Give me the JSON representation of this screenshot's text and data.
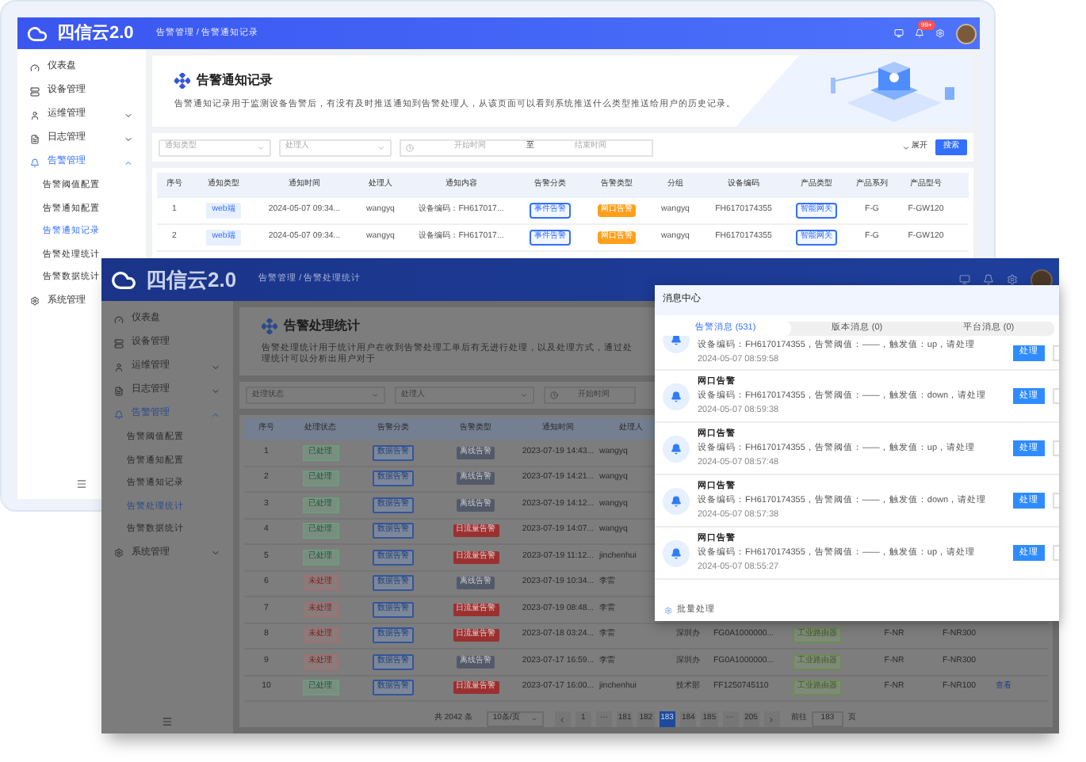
{
  "back_window": {
    "app_name": "四信云2.0",
    "breadcrumb": "告警管理 / 告警通知记录",
    "badge": "99+",
    "sidebar": [
      {
        "label": "仪表盘",
        "kind": "dashboard",
        "expandable": false,
        "expanded": false,
        "selected": false
      },
      {
        "label": "设备管理",
        "kind": "device",
        "expandable": false,
        "expanded": false,
        "selected": false
      },
      {
        "label": "运维管理",
        "kind": "ops",
        "expandable": true,
        "expanded": false,
        "selected": false
      },
      {
        "label": "日志管理",
        "kind": "log",
        "expandable": true,
        "expanded": false,
        "selected": false
      },
      {
        "label": "告警管理",
        "kind": "alarm",
        "expandable": true,
        "expanded": true,
        "selected": true,
        "children": [
          {
            "label": "告警阈值配置",
            "selected": false
          },
          {
            "label": "告警通知配置",
            "selected": false
          },
          {
            "label": "告警通知记录",
            "selected": true
          },
          {
            "label": "告警处理统计",
            "selected": false
          },
          {
            "label": "告警数据统计",
            "selected": false
          }
        ]
      },
      {
        "label": "系统管理",
        "kind": "system",
        "expandable": false,
        "expanded": false,
        "selected": false
      }
    ],
    "banner": {
      "title": "告警通知记录",
      "description": "告警通知记录用于监测设备告警后，有没有及时推送通知到告警处理人，从该页面可以看到系统推送什么类型推送给用户的历史记录。"
    },
    "filters": [
      {
        "placeholder": "通知类型"
      },
      {
        "placeholder": "处理人"
      }
    ],
    "date_range": {
      "start_placeholder": "开始时间",
      "separator": "至",
      "end_placeholder": "结束时间"
    },
    "expand_label": "展开",
    "search_button": "搜索",
    "table": {
      "columns": [
        {
          "label": "序号",
          "kind": "text"
        },
        {
          "label": "通知类型",
          "kind": "tag"
        },
        {
          "label": "通知时间",
          "kind": "text"
        },
        {
          "label": "处理人",
          "kind": "text"
        },
        {
          "label": "通知内容",
          "kind": "text"
        },
        {
          "label": "告警分类",
          "kind": "outline"
        },
        {
          "label": "告警类型",
          "kind": "warn"
        },
        {
          "label": "分组",
          "kind": "text"
        },
        {
          "label": "设备编码",
          "kind": "text"
        },
        {
          "label": "产品类型",
          "kind": "outline"
        },
        {
          "label": "产品系列",
          "kind": "text"
        },
        {
          "label": "产品型号",
          "kind": "text"
        }
      ],
      "rows": [
        {
          "cells": [
            "1",
            "web端",
            "2024-05-07 09:34...",
            "wangyq",
            "设备编码：FH617017...",
            "事件告警",
            "网口告警",
            "wangyq",
            "FH6170174355",
            "智能网关",
            "F-G",
            "F-GW120"
          ]
        },
        {
          "cells": [
            "2",
            "web端",
            "2024-05-07 09:34...",
            "wangyq",
            "设备编码：FH617017...",
            "事件告警",
            "网口告警",
            "wangyq",
            "FH6170174355",
            "智能网关",
            "F-G",
            "F-GW120"
          ]
        }
      ]
    }
  },
  "front_window": {
    "app_name": "四信云2.0",
    "breadcrumb": "告警管理 / 告警处理统计",
    "sidebar": [
      {
        "label": "仪表盘",
        "kind": "dashboard",
        "expandable": false,
        "expanded": false,
        "selected": false
      },
      {
        "label": "设备管理",
        "kind": "device",
        "expandable": false,
        "expanded": false,
        "selected": false
      },
      {
        "label": "运维管理",
        "kind": "ops",
        "expandable": true,
        "expanded": false,
        "selected": false
      },
      {
        "label": "日志管理",
        "kind": "log",
        "expandable": true,
        "expanded": false,
        "selected": false
      },
      {
        "label": "告警管理",
        "kind": "alarm",
        "expandable": true,
        "expanded": true,
        "selected": true,
        "children": [
          {
            "label": "告警阈值配置",
            "selected": false
          },
          {
            "label": "告警通知配置",
            "selected": false
          },
          {
            "label": "告警通知记录",
            "selected": false
          },
          {
            "label": "告警处理统计",
            "selected": true
          },
          {
            "label": "告警数据统计",
            "selected": false
          }
        ]
      },
      {
        "label": "系统管理",
        "kind": "system",
        "expandable": true,
        "expanded": false,
        "selected": false
      }
    ],
    "banner": {
      "title": "告警处理统计",
      "description": "告警处理统计用于统计用户在收到告警处理工单后有无进行处理，以及处理方式，通过处理统计可以分析出用户对于"
    },
    "filters": [
      {
        "placeholder": "处理状态"
      },
      {
        "placeholder": "处理人"
      }
    ],
    "date_start_placeholder": "开始时间",
    "table": {
      "columns": [
        "序号",
        "处理状态",
        "告警分类",
        "告警类型",
        "通知时间",
        "处理人"
      ],
      "rows": [
        {
          "number": "1",
          "status": "已处理",
          "handled": true,
          "category": "数据告警",
          "type": {
            "label": "离线告警",
            "kind": "offline"
          },
          "time": "2023-07-19 14:43...",
          "processor": "wangyq"
        },
        {
          "number": "2",
          "status": "已处理",
          "handled": true,
          "category": "数据告警",
          "type": {
            "label": "离线告警",
            "kind": "offline"
          },
          "time": "2023-07-19 14:21...",
          "processor": "wangyq"
        },
        {
          "number": "3",
          "status": "已处理",
          "handled": true,
          "category": "数据告警",
          "type": {
            "label": "离线告警",
            "kind": "offline"
          },
          "time": "2023-07-19 14:12...",
          "processor": "wangyq"
        },
        {
          "number": "4",
          "status": "已处理",
          "handled": true,
          "category": "数据告警",
          "type": {
            "label": "日流量告警",
            "kind": "traffic"
          },
          "time": "2023-07-19 14:07...",
          "processor": "wangyq"
        },
        {
          "number": "5",
          "status": "已处理",
          "handled": true,
          "category": "数据告警",
          "type": {
            "label": "日流量告警",
            "kind": "traffic"
          },
          "time": "2023-07-19 11:12...",
          "processor": "jinchenhui"
        },
        {
          "number": "6",
          "status": "未处理",
          "handled": false,
          "category": "数据告警",
          "type": {
            "label": "离线告警",
            "kind": "offline"
          },
          "time": "2023-07-19 10:34...",
          "processor": "李雷"
        },
        {
          "number": "7",
          "status": "未处理",
          "handled": false,
          "category": "数据告警",
          "type": {
            "label": "日流量告警",
            "kind": "traffic"
          },
          "time": "2023-07-19 08:48...",
          "processor": "李雷"
        },
        {
          "number": "8",
          "status": "未处理",
          "handled": false,
          "category": "数据告警",
          "type": {
            "label": "日流量告警",
            "kind": "traffic"
          },
          "time": "2023-07-18 03:24...",
          "processor": "李雷",
          "department": "深圳办",
          "device_code": "FG0A1000000...",
          "product_type": "工业路由器",
          "series": "F-NR",
          "model": "F-NR300"
        },
        {
          "number": "9",
          "status": "未处理",
          "handled": false,
          "category": "数据告警",
          "type": {
            "label": "离线告警",
            "kind": "offline"
          },
          "time": "2023-07-17 16:59...",
          "processor": "李雷",
          "department": "深圳办",
          "device_code": "FG0A1000000...",
          "product_type": "工业路由器",
          "series": "F-NR",
          "model": "F-NR300"
        },
        {
          "number": "10",
          "status": "已处理",
          "handled": true,
          "category": "数据告警",
          "type": {
            "label": "日流量告警",
            "kind": "traffic"
          },
          "time": "2023-07-17 16:00...",
          "processor": "jinchenhui",
          "department": "技术部",
          "device_code": "FF1250745110",
          "product_type": "工业路由器",
          "series": "F-NR",
          "model": "F-NR100",
          "action": "查看"
        }
      ]
    },
    "pagination": {
      "total": "共 2042 条",
      "page_size": "10条/页",
      "pages": [
        {
          "label": "1",
          "selected": false
        },
        {
          "label": "···",
          "selected": false
        },
        {
          "label": "181",
          "selected": false
        },
        {
          "label": "182",
          "selected": false
        },
        {
          "label": "183",
          "selected": true
        },
        {
          "label": "184",
          "selected": false
        },
        {
          "label": "185",
          "selected": false
        },
        {
          "label": "···",
          "selected": false
        },
        {
          "label": "205",
          "selected": false
        }
      ],
      "goto_label": "前往",
      "goto_value": "183",
      "goto_suffix": "页"
    },
    "message_center": {
      "title": "消息中心",
      "tabs": [
        {
          "label": "告警消息 (531)",
          "selected": true
        },
        {
          "label": "版本消息 (0)",
          "selected": false
        },
        {
          "label": "平台消息 (0)",
          "selected": false
        }
      ],
      "messages": [
        {
          "text": "设备编码：FH6170174355，告警阈值：——，触发值：up，请处理",
          "time": "2024-05-07 08:59:58",
          "button": "处理"
        },
        {
          "title": "网口告警",
          "text": "设备编码：FH6170174355，告警阈值：——，触发值：down，请处理",
          "time": "2024-05-07 08:59:38",
          "button": "处理"
        },
        {
          "title": "网口告警",
          "text": "设备编码：FH6170174355，告警阈值：——，触发值：up，请处理",
          "time": "2024-05-07 08:57:48",
          "button": "处理"
        },
        {
          "title": "网口告警",
          "text": "设备编码：FH6170174355，告警阈值：——，触发值：down，请处理",
          "time": "2024-05-07 08:57:38",
          "button": "处理"
        },
        {
          "title": "网口告警",
          "text": "设备编码：FH6170174355，告警阈值：——，触发值：up，请处理",
          "time": "2024-05-07 08:55:27",
          "button": "处理"
        }
      ],
      "footer": "批量处理"
    }
  }
}
